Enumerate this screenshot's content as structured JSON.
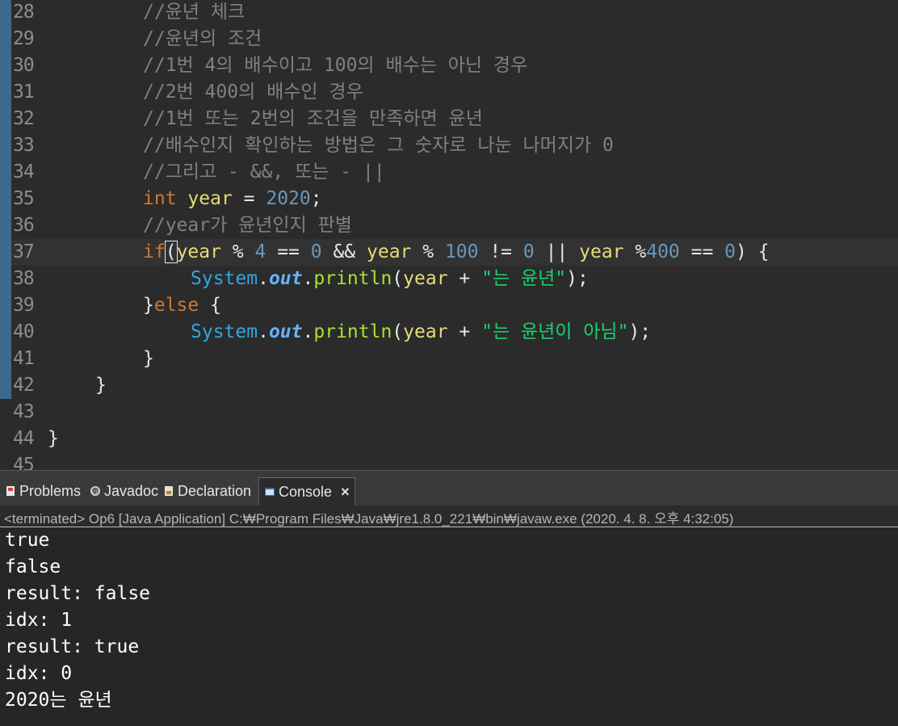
{
  "editor": {
    "lines": [
      {
        "num": "28",
        "changed": true
      },
      {
        "num": "29",
        "changed": true
      },
      {
        "num": "30",
        "changed": true
      },
      {
        "num": "31",
        "changed": true
      },
      {
        "num": "32",
        "changed": true
      },
      {
        "num": "33",
        "changed": true
      },
      {
        "num": "34",
        "changed": true
      },
      {
        "num": "35",
        "changed": true
      },
      {
        "num": "36",
        "changed": true
      },
      {
        "num": "37",
        "changed": true
      },
      {
        "num": "38",
        "changed": true
      },
      {
        "num": "39",
        "changed": true
      },
      {
        "num": "40",
        "changed": true
      },
      {
        "num": "41",
        "changed": true
      },
      {
        "num": "42",
        "changed": true
      },
      {
        "num": "43",
        "changed": false
      },
      {
        "num": "44",
        "changed": false
      },
      {
        "num": "45",
        "changed": false
      }
    ],
    "code": {
      "l28": "//윤년 체크",
      "l29": "//윤년의 조건",
      "l30": "//1번 4의 배수이고 100의 배수는 아닌 경우",
      "l31": "//2번 400의 배수인 경우",
      "l32": "//1번 또는 2번의 조건을 만족하면 윤년",
      "l33": "//배수인지 확인하는 방법은 그 숫자로 나눈 나머지가 0",
      "l34": "//그리고 - &&, 또는 - ||",
      "l35": {
        "kw": "int",
        "var": "year",
        "op": " = ",
        "num": "2020",
        "end": ";"
      },
      "l36": "//year가 윤년인지 판별",
      "l37": {
        "kw": "if",
        "paren": "(",
        "v1": "year",
        "o1": " % ",
        "n1": "4",
        "o2": " == ",
        "n2": "0",
        "o3": " && ",
        "v2": "year",
        "o4": " % ",
        "n3": "100",
        "o5": " != ",
        "n4": "0",
        "o6": " || ",
        "v3": "year",
        "o7": " %",
        "n5": "400",
        "o8": " == ",
        "n6": "0",
        "end": ") {"
      },
      "l38": {
        "cls": "System",
        "dot1": ".",
        "field": "out",
        "dot2": ".",
        "meth": "println",
        "open": "(",
        "var": "year",
        "op": " + ",
        "str": "\"는 윤년\"",
        "end": ");"
      },
      "l39": {
        "brace": "}",
        "kw": "else",
        "end": " {"
      },
      "l40": {
        "cls": "System",
        "dot1": ".",
        "field": "out",
        "dot2": ".",
        "meth": "println",
        "open": "(",
        "var": "year",
        "op": " + ",
        "str": "\"는 윤년이 아님\"",
        "end": ");"
      },
      "l41": "}",
      "l42": "}",
      "l44": "}"
    }
  },
  "tabs": [
    {
      "label": "Problems",
      "icon": "problems-icon",
      "color": "#e05050"
    },
    {
      "label": "Javadoc",
      "icon": "javadoc-icon",
      "color": "#cfcfcf"
    },
    {
      "label": "Declaration",
      "icon": "declaration-icon",
      "color": "#d8b060"
    },
    {
      "label": "Console",
      "icon": "console-icon",
      "color": "#7fa7d8",
      "close": "×"
    }
  ],
  "console": {
    "header": "<terminated> Op6 [Java Application] C:₩Program Files₩Java₩jre1.8.0_221₩bin₩javaw.exe (2020. 4. 8. 오후 4:32:05)",
    "output": [
      "true",
      "false",
      "result: false",
      "idx: 1",
      "result: true",
      "idx: 0",
      "2020는 윤년"
    ]
  }
}
